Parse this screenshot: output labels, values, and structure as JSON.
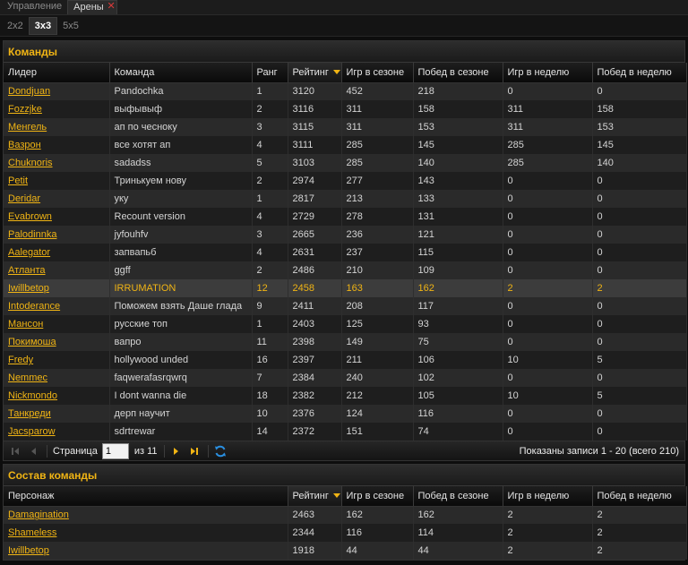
{
  "top_tabs": [
    "Управление",
    "Арены"
  ],
  "arena_tabs": [
    "2x2",
    "3x3",
    "5x5"
  ],
  "teams": {
    "title": "Команды",
    "columns": [
      "Лидер",
      "Команда",
      "Ранг",
      "Рейтинг",
      "Игр в сезоне",
      "Побед в сезоне",
      "Игр в неделю",
      "Побед в неделю"
    ],
    "rows": [
      [
        "Dondjuan",
        "Pandochka",
        "1",
        "3120",
        "452",
        "218",
        "0",
        "0"
      ],
      [
        "Fozzjke",
        "выфывыф",
        "2",
        "3116",
        "311",
        "158",
        "311",
        "158"
      ],
      [
        "Менгель",
        "ап по чесноку",
        "3",
        "3115",
        "311",
        "153",
        "311",
        "153"
      ],
      [
        "Вазрон",
        "все хотят ап",
        "4",
        "3111",
        "285",
        "145",
        "285",
        "145"
      ],
      [
        "Chuknoris",
        "sadadss",
        "5",
        "3103",
        "285",
        "140",
        "285",
        "140"
      ],
      [
        "Petit",
        "Тринькуем нову",
        "2",
        "2974",
        "277",
        "143",
        "0",
        "0"
      ],
      [
        "Deridar",
        "уку",
        "1",
        "2817",
        "213",
        "133",
        "0",
        "0"
      ],
      [
        "Evabrown",
        "Recount version",
        "4",
        "2729",
        "278",
        "131",
        "0",
        "0"
      ],
      [
        "Palodinnka",
        "jyfouhfv",
        "3",
        "2665",
        "236",
        "121",
        "0",
        "0"
      ],
      [
        "Aalegator",
        "запвапьб",
        "4",
        "2631",
        "237",
        "115",
        "0",
        "0"
      ],
      [
        "Атланта",
        "ggff",
        "2",
        "2486",
        "210",
        "109",
        "0",
        "0"
      ],
      [
        "Iwillbetop",
        "IRRUMATION",
        "12",
        "2458",
        "163",
        "162",
        "2",
        "2"
      ],
      [
        "Intoderance",
        "Поможем взять Даше глада",
        "9",
        "2411",
        "208",
        "117",
        "0",
        "0"
      ],
      [
        "Мансон",
        "русские топ",
        "1",
        "2403",
        "125",
        "93",
        "0",
        "0"
      ],
      [
        "Покимоша",
        "вапро",
        "11",
        "2398",
        "149",
        "75",
        "0",
        "0"
      ],
      [
        "Fredy",
        "hollywood unded",
        "16",
        "2397",
        "211",
        "106",
        "10",
        "5"
      ],
      [
        "Nemmec",
        "faqwerafasrqwrq",
        "7",
        "2384",
        "240",
        "102",
        "0",
        "0"
      ],
      [
        "Nickmondo",
        "I dont wanna die",
        "18",
        "2382",
        "212",
        "105",
        "10",
        "5"
      ],
      [
        "Танкреди",
        "дерп научит",
        "10",
        "2376",
        "124",
        "116",
        "0",
        "0"
      ],
      [
        "Jacsparow",
        "sdrtrewar",
        "14",
        "2372",
        "151",
        "74",
        "0",
        "0"
      ]
    ]
  },
  "pager": {
    "page_label": "Страница",
    "page_value": "1",
    "of_label": "из 11",
    "status": "Показаны записи 1 - 20 (всего 210)"
  },
  "roster": {
    "title": "Состав команды",
    "columns": [
      "Персонаж",
      "Рейтинг",
      "Игр в сезоне",
      "Побед в сезоне",
      "Игр в неделю",
      "Побед в неделю"
    ],
    "rows": [
      [
        "Damagination",
        "2463",
        "162",
        "162",
        "2",
        "2"
      ],
      [
        "Shameless",
        "2344",
        "116",
        "114",
        "2",
        "2"
      ],
      [
        "Iwillbetop",
        "1918",
        "44",
        "44",
        "2",
        "2"
      ]
    ]
  },
  "colors": {
    "accent": "#f0b414",
    "close": "#d83a3a",
    "refresh": "#2a8fe0"
  },
  "icons": [
    "first-page-icon",
    "prev-page-icon",
    "next-page-icon",
    "last-page-icon",
    "refresh-icon",
    "close-icon",
    "sort-desc-icon"
  ]
}
